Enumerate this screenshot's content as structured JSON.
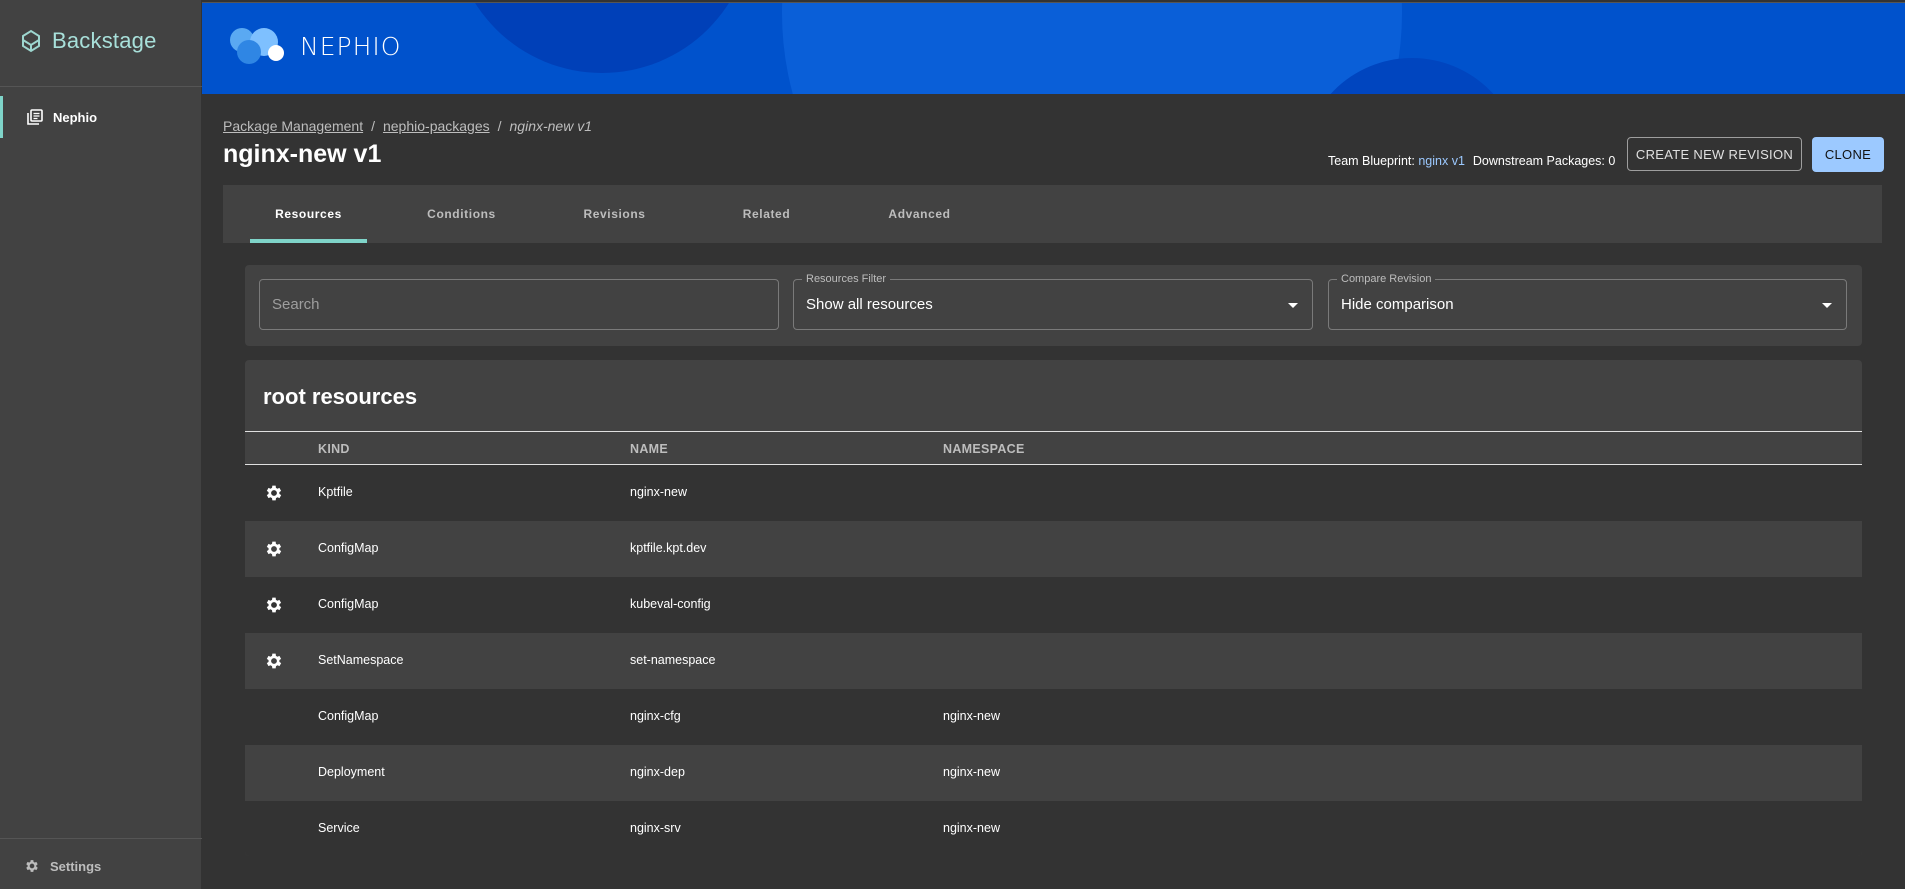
{
  "sidebar": {
    "brand": "Backstage",
    "nav_item": "Nephio",
    "settings": "Settings"
  },
  "banner": {
    "logo_text": "NEPHIO"
  },
  "breadcrumbs": [
    "Package Management",
    "nephio-packages",
    "nginx-new v1"
  ],
  "page": {
    "title": "nginx-new v1",
    "team_blueprint_label": "Team Blueprint:",
    "team_blueprint_value": "nginx v1",
    "downstream_label": "Downstream Packages: 0",
    "create_revision": "CREATE NEW REVISION",
    "clone": "CLONE"
  },
  "tabs": [
    "Resources",
    "Conditions",
    "Revisions",
    "Related",
    "Advanced"
  ],
  "filters": {
    "search_placeholder": "Search",
    "resources_filter_label": "Resources Filter",
    "resources_filter_value": "Show all resources",
    "compare_label": "Compare Revision",
    "compare_value": "Hide comparison"
  },
  "resources": {
    "title": "root resources",
    "columns": [
      "KIND",
      "NAME",
      "NAMESPACE"
    ],
    "rows": [
      {
        "kind": "Kptfile",
        "name": "nginx-new",
        "namespace": "",
        "gear": true
      },
      {
        "kind": "ConfigMap",
        "name": "kptfile.kpt.dev",
        "namespace": "",
        "gear": true
      },
      {
        "kind": "ConfigMap",
        "name": "kubeval-config",
        "namespace": "",
        "gear": true
      },
      {
        "kind": "SetNamespace",
        "name": "set-namespace",
        "namespace": "",
        "gear": true
      },
      {
        "kind": "ConfigMap",
        "name": "nginx-cfg",
        "namespace": "nginx-new",
        "gear": false
      },
      {
        "kind": "Deployment",
        "name": "nginx-dep",
        "namespace": "nginx-new",
        "gear": false
      },
      {
        "kind": "Service",
        "name": "nginx-srv",
        "namespace": "nginx-new",
        "gear": false
      }
    ]
  },
  "colors": {
    "accent": "#7fd4c9",
    "primary": "#9cc9ff",
    "banner": "#0052cc"
  }
}
